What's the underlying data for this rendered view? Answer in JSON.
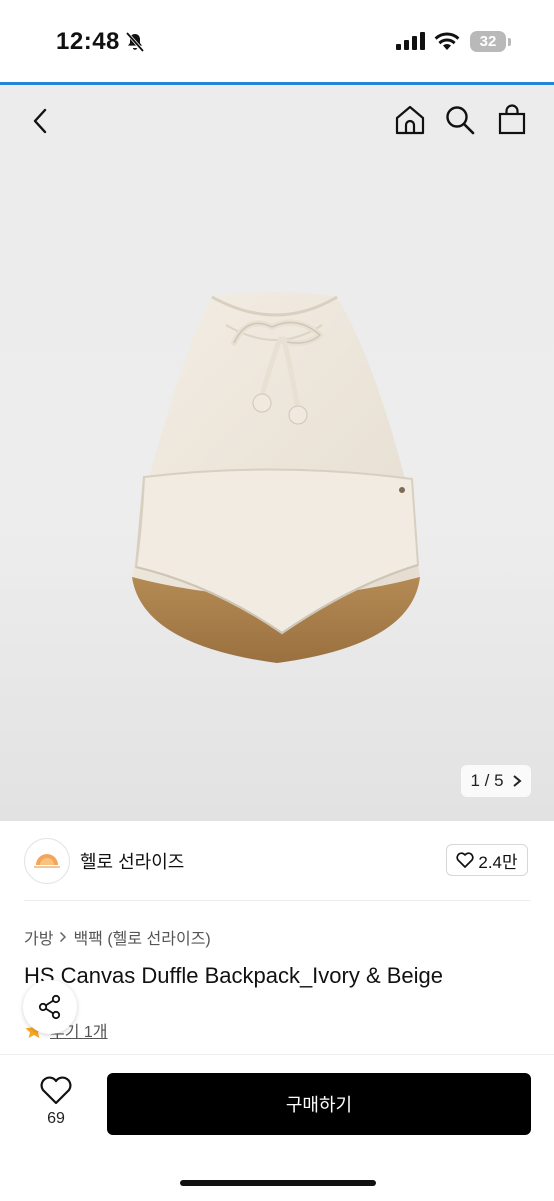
{
  "status_bar": {
    "time": "12:48",
    "battery": "32"
  },
  "gallery": {
    "counter": "1 / 5"
  },
  "brand": {
    "name": "헬로 선라이즈",
    "likes": "2.4만"
  },
  "breadcrumb": {
    "category": "가방",
    "subcategory": "백팩 (헬로 선라이즈)"
  },
  "product": {
    "title": "HS Canvas Duffle Backpack_Ivory & Beige"
  },
  "review": {
    "label": "후기 1개"
  },
  "bottom_bar": {
    "wish_count": "69",
    "buy_label": "구매하기"
  },
  "colors": {
    "accent_line": "#1f86d9",
    "buy_button": "#000000",
    "star": "#f5a623"
  },
  "icons": [
    "back-icon",
    "home-icon",
    "search-icon",
    "shopping-bag-icon",
    "heart-icon",
    "share-icon",
    "star-icon",
    "chevron-right-icon",
    "bell-slash-icon",
    "signal-icon",
    "wifi-icon"
  ]
}
